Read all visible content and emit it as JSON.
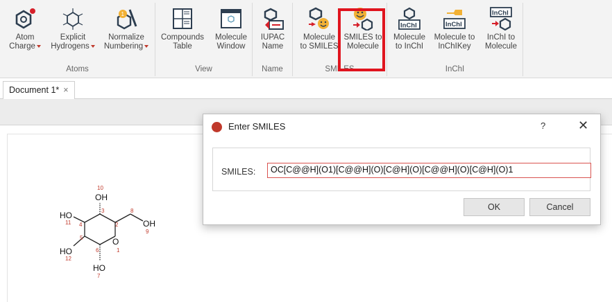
{
  "ribbon": {
    "groups": [
      {
        "label": "Atoms",
        "buttons": [
          "Atom\nCharge",
          "Explicit\nHydrogens",
          "Normalize\nNumbering"
        ]
      },
      {
        "label": "View",
        "buttons": [
          "Compounds\nTable",
          "Molecule\nWindow"
        ]
      },
      {
        "label": "Name",
        "buttons": [
          "IUPAC\nName"
        ]
      },
      {
        "label": "SMILES",
        "buttons": [
          "Molecule\nto SMILES",
          "SMILES to\nMolecule"
        ]
      },
      {
        "label": "InChI",
        "buttons": [
          "Molecule\nto InChI",
          "Molecule to\nInChIKey",
          "InChI to\nMolecule"
        ]
      }
    ],
    "inchi_text": "InChI",
    "accent_color": "#e0141e"
  },
  "document_tab": {
    "label": "Document 1*",
    "close": "×"
  },
  "dialog": {
    "title": "Enter SMILES",
    "help": "?",
    "close": "✕",
    "smiles_label": "SMILES:",
    "smiles_value": "OC[C@@H](O1)[C@@H](O)[C@H](O)[C@@H](O)[C@H](O)1",
    "ok_label": "OK",
    "cancel_label": "Cancel"
  },
  "molecule": {
    "labels": {
      "oh_top": "OH",
      "oh_right": "OH",
      "ho_left": "HO",
      "ho_lower": "HO",
      "ho_bottom": "HO",
      "ring_o": "O"
    },
    "atom_numbers": [
      "10",
      "11",
      "4",
      "3",
      "2",
      "8",
      "9",
      "5",
      "6",
      "1",
      "12",
      "7"
    ]
  }
}
